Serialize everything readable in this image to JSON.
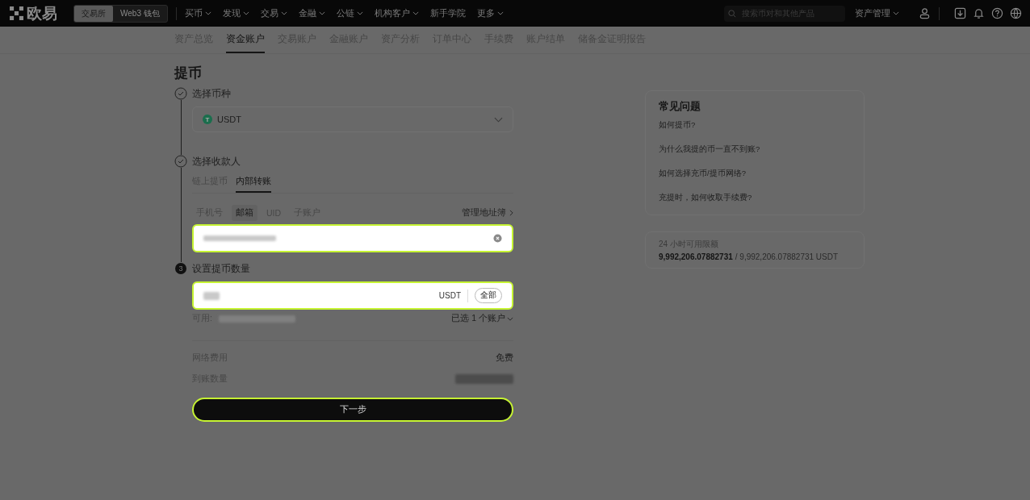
{
  "header": {
    "logo": "欧易",
    "modes": [
      {
        "label": "交易所",
        "selected": true
      },
      {
        "label": "Web3 钱包",
        "selected": false
      }
    ],
    "nav": [
      {
        "label": "买币",
        "caret": true
      },
      {
        "label": "发现",
        "caret": true
      },
      {
        "label": "交易",
        "caret": true
      },
      {
        "label": "金融",
        "caret": true
      },
      {
        "label": "公链",
        "caret": true
      },
      {
        "label": "机构客户",
        "caret": true
      },
      {
        "label": "新手学院",
        "caret": false
      },
      {
        "label": "更多",
        "caret": true
      }
    ],
    "search": {
      "placeholder": "搜索币对和其他产品"
    },
    "asset_menu": "资产管理"
  },
  "subnav": [
    {
      "label": "资产总览",
      "selected": false
    },
    {
      "label": "资金账户",
      "selected": true
    },
    {
      "label": "交易账户",
      "selected": false
    },
    {
      "label": "金融账户",
      "selected": false
    },
    {
      "label": "资产分析",
      "selected": false
    },
    {
      "label": "订单中心",
      "selected": false
    },
    {
      "label": "手续费",
      "selected": false
    },
    {
      "label": "账户结单",
      "selected": false
    },
    {
      "label": "储备金证明报告",
      "selected": false
    }
  ],
  "title": "提币",
  "steps": [
    {
      "kind": "done",
      "label": "选择币种"
    },
    {
      "kind": "done",
      "label": "选择收款人"
    },
    {
      "kind": "current",
      "number": "3",
      "label": "设置提币数量"
    }
  ],
  "coin_select": {
    "symbol": "T",
    "value": "USDT"
  },
  "recipient_tabs": [
    {
      "label": "链上提币",
      "selected": false
    },
    {
      "label": "内部转账",
      "selected": true
    }
  ],
  "recipient_types": [
    {
      "label": "手机号",
      "selected": false
    },
    {
      "label": "邮箱",
      "selected": true
    },
    {
      "label": "UID",
      "selected": false
    },
    {
      "label": "子账户",
      "selected": false
    }
  ],
  "address_book_link": "管理地址簿",
  "amount": {
    "unit": "USDT",
    "all_button": "全部",
    "available_label": "可用:",
    "accounts": "已选 1 个账户"
  },
  "summary": [
    {
      "label": "网络费用",
      "value": "免费"
    },
    {
      "label": "到账数量"
    }
  ],
  "next_button": "下一步",
  "faq": {
    "title": "常见问题",
    "items": [
      "如何提币?",
      "为什么我提的币一直不到账?",
      "如何选择充币/提币网络?",
      "充提时，如何收取手续费?"
    ]
  },
  "limit": {
    "label": "24 小时可用限额",
    "used": "9,992,206.07882731",
    "total": "/ 9,992,206.07882731 USDT"
  }
}
